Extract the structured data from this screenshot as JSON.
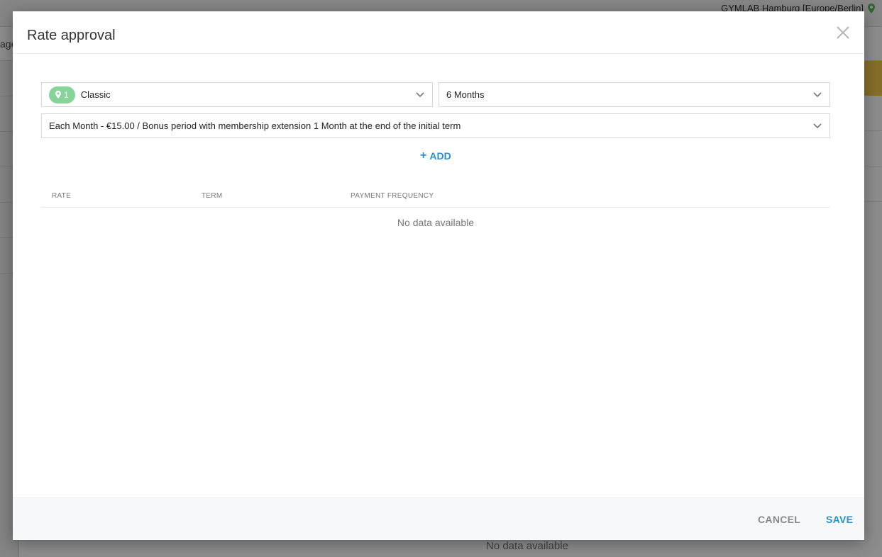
{
  "background": {
    "location_label": "GYMLAB Hamburg [Europe/Berlin]",
    "tab_fragment": "age",
    "no_data_text": "No data available"
  },
  "modal": {
    "title": "Rate approval",
    "rate_select": {
      "badge_count": "1",
      "value": "Classic"
    },
    "term_select": {
      "value": "6 Months"
    },
    "frequency_select": {
      "value": "Each Month - €15.00 / Bonus period with membership extension 1 Month at the end of the initial term"
    },
    "add_label": "ADD",
    "table": {
      "columns": [
        "RATE",
        "TERM",
        "PAYMENT FREQUENCY"
      ],
      "empty_text": "No data available"
    },
    "footer": {
      "cancel_label": "CANCEL",
      "save_label": "SAVE"
    }
  },
  "colors": {
    "accent": "#2a8fc7",
    "badge": "#87d49a",
    "location_pin": "#5cb85c"
  },
  "icons": {
    "close": "close-icon",
    "chevron": "chevron-down-icon",
    "pin": "map-pin-icon",
    "plus": "plus-icon"
  }
}
